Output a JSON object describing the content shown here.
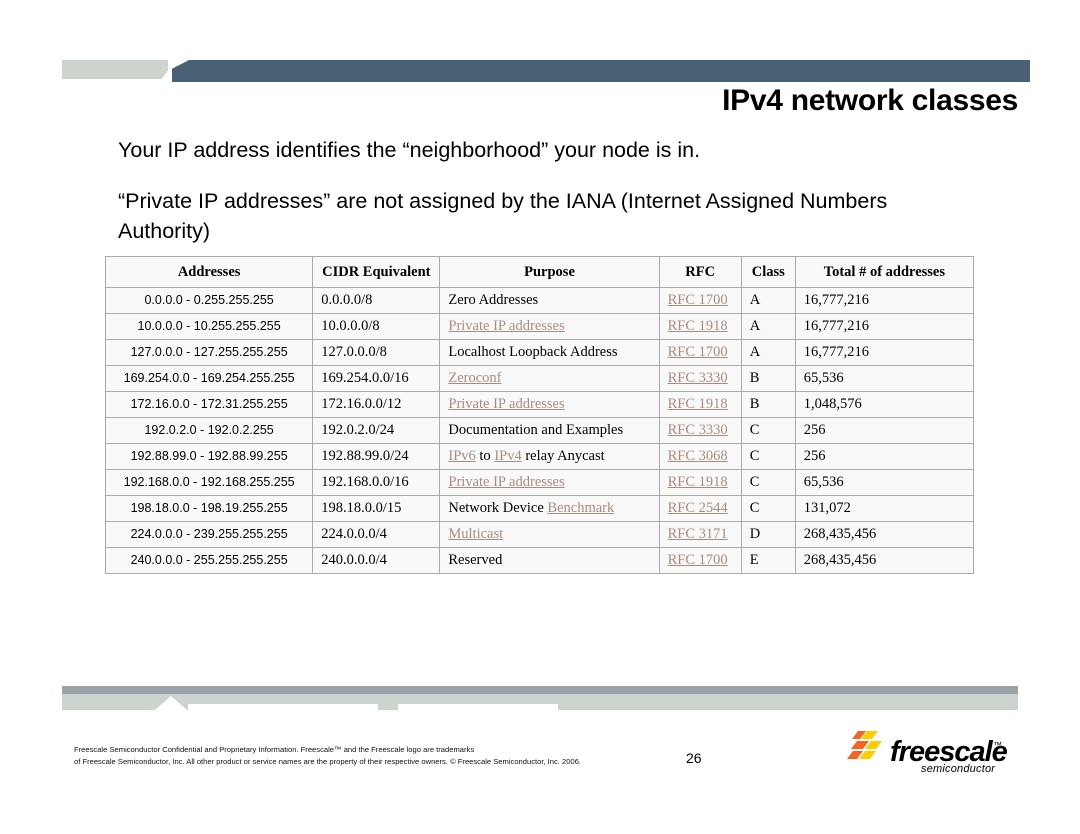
{
  "slide": {
    "title": "IPv4 network classes",
    "page_number": "26",
    "bullets": [
      "Your IP address identifies the “neighborhood” your node is in.",
      "“Private IP addresses” are not assigned by the IANA (Internet Assigned Numbers Authority)"
    ]
  },
  "colors": {
    "header_bar_dark": "#4a6075",
    "header_bar_light": "#ccd4ce",
    "footer_bar_dark": "#9aa3a7",
    "footer_bar_light": "#ccd4ce",
    "link": "#a88d7d",
    "table_bg": "#f9f9f9",
    "table_border": "#aaaaaa",
    "logo_orange": "#f26522",
    "logo_yellow": "#ffcc00"
  },
  "table": {
    "headers": [
      "Addresses",
      "CIDR Equivalent",
      "Purpose",
      "RFC",
      "Class",
      "Total # of addresses"
    ],
    "rows": [
      {
        "addresses": "0.0.0.0 - 0.255.255.255",
        "cidr": "0.0.0.0/8",
        "purpose": "Zero Addresses",
        "purpose_link": "",
        "purpose_pre": "Zero Addresses",
        "purpose_post": "",
        "rfc": "RFC 1700",
        "class": "A",
        "total": "16,777,216"
      },
      {
        "addresses": "10.0.0.0 - 10.255.255.255",
        "cidr": "10.0.0.0/8",
        "purpose": "Private IP addresses",
        "purpose_link": "Private IP addresses",
        "purpose_pre": "",
        "purpose_post": "",
        "rfc": "RFC 1918",
        "class": "A",
        "total": "16,777,216"
      },
      {
        "addresses": "127.0.0.0 - 127.255.255.255",
        "cidr": "127.0.0.0/8",
        "purpose": "Localhost Loopback Address",
        "purpose_link": "",
        "purpose_pre": "Localhost Loopback Address",
        "purpose_post": "",
        "rfc": "RFC 1700",
        "class": "A",
        "total": "16,777,216"
      },
      {
        "addresses": "169.254.0.0 - 169.254.255.255",
        "cidr": "169.254.0.0/16",
        "purpose": "Zeroconf",
        "purpose_link": "Zeroconf",
        "purpose_pre": "",
        "purpose_post": "",
        "rfc": "RFC 3330",
        "class": "B",
        "total": "65,536"
      },
      {
        "addresses": "172.16.0.0 - 172.31.255.255",
        "cidr": "172.16.0.0/12",
        "purpose": "Private IP addresses",
        "purpose_link": "Private IP addresses",
        "purpose_pre": "",
        "purpose_post": "",
        "rfc": "RFC 1918",
        "class": "B",
        "total": "1,048,576"
      },
      {
        "addresses": "192.0.2.0 - 192.0.2.255",
        "cidr": "192.0.2.0/24",
        "purpose": "Documentation and Examples",
        "purpose_link": "",
        "purpose_pre": "Documentation and Examples",
        "purpose_post": "",
        "rfc": "RFC 3330",
        "class": "C",
        "total": "256"
      },
      {
        "addresses": "192.88.99.0 - 192.88.99.255",
        "cidr": "192.88.99.0/24",
        "purpose": "IPv6 to IPv4 relay Anycast",
        "purpose_link": "IPv6",
        "purpose_pre": "",
        "purpose_mid": " to ",
        "purpose_link2": "IPv4",
        "purpose_post": " relay Anycast",
        "rfc": "RFC 3068",
        "class": "C",
        "total": "256"
      },
      {
        "addresses": "192.168.0.0 - 192.168.255.255",
        "cidr": "192.168.0.0/16",
        "purpose": "Private IP addresses",
        "purpose_link": "Private IP addresses",
        "purpose_pre": "",
        "purpose_post": "",
        "rfc": "RFC 1918",
        "class": "C",
        "total": "65,536"
      },
      {
        "addresses": "198.18.0.0 - 198.19.255.255",
        "cidr": "198.18.0.0/15",
        "purpose": "Network Device Benchmark",
        "purpose_link": "Benchmark",
        "purpose_pre": "Network Device ",
        "purpose_post": "",
        "rfc": "RFC 2544",
        "class": "C",
        "total": "131,072"
      },
      {
        "addresses": "224.0.0.0 - 239.255.255.255",
        "cidr": "224.0.0.0/4",
        "purpose": "Multicast",
        "purpose_link": "Multicast",
        "purpose_pre": "",
        "purpose_post": "",
        "rfc": "RFC 3171",
        "class": "D",
        "total": "268,435,456"
      },
      {
        "addresses": "240.0.0.0 - 255.255.255.255",
        "cidr": "240.0.0.0/4",
        "purpose": "Reserved",
        "purpose_link": "",
        "purpose_pre": "Reserved",
        "purpose_post": "",
        "rfc": "RFC 1700",
        "class": "E",
        "total": "268,435,456"
      }
    ]
  },
  "footer": {
    "legal_line1": "Freescale Semiconductor Confidential and Proprietary Information. Freescale™ and the Freescale logo are trademarks",
    "legal_line2": "of Freescale Semiconductor, Inc. All other product or service names are the property of their respective owners. © Freescale Semiconductor, Inc. 2006."
  },
  "logo": {
    "wordmark": "freescale",
    "trademark": "™",
    "subtitle": "semiconductor"
  }
}
